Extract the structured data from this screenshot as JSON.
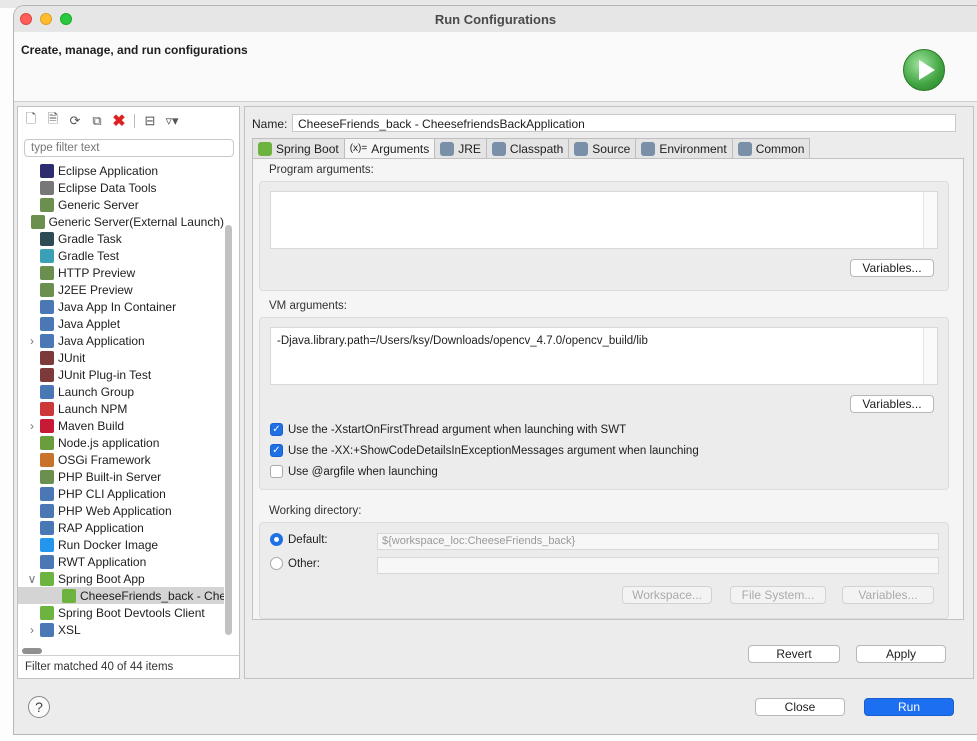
{
  "dialog": {
    "title": "Run Configurations",
    "header_text": "Create, manage, and run configurations",
    "header_icon": "run-icon"
  },
  "left_panel": {
    "filter_placeholder": "type filter text",
    "status": "Filter matched 40 of 44 items",
    "toolbar_icons": [
      "new-configuration-icon",
      "new-prototype-icon",
      "export-icon",
      "duplicate-icon",
      "delete-icon",
      "collapse-all-icon",
      "filter-icon"
    ],
    "tree": [
      {
        "label": "Eclipse Application",
        "icon": "eclipse-icon",
        "color": "#2c2c6e",
        "expandable": false
      },
      {
        "label": "Eclipse Data Tools",
        "icon": "database-icon",
        "color": "#777777",
        "expandable": false
      },
      {
        "label": "Generic Server",
        "icon": "server-icon",
        "color": "#6a8f4e",
        "expandable": false
      },
      {
        "label": "Generic Server(External Launch)",
        "icon": "server-icon",
        "color": "#6a8f4e",
        "expandable": false
      },
      {
        "label": "Gradle Task",
        "icon": "gradle-icon",
        "color": "#2d4b54",
        "expandable": false
      },
      {
        "label": "Gradle Test",
        "icon": "gradle-icon",
        "color": "#3aa0b5",
        "expandable": false
      },
      {
        "label": "HTTP Preview",
        "icon": "document-icon",
        "color": "#6a8f4e",
        "expandable": false
      },
      {
        "label": "J2EE Preview",
        "icon": "document-icon",
        "color": "#6a8f4e",
        "expandable": false
      },
      {
        "label": "Java App In Container",
        "icon": "container-icon",
        "color": "#4a78b5",
        "expandable": false
      },
      {
        "label": "Java Applet",
        "icon": "applet-icon",
        "color": "#4a78b5",
        "expandable": false
      },
      {
        "label": "Java Application",
        "icon": "java-icon",
        "color": "#4a78b5",
        "expandable": true,
        "expanded": false
      },
      {
        "label": "JUnit",
        "icon": "junit-icon",
        "color": "#7d3a3a",
        "expandable": false
      },
      {
        "label": "JUnit Plug-in Test",
        "icon": "junit-icon",
        "color": "#7d3a3a",
        "expandable": false
      },
      {
        "label": "Launch Group",
        "icon": "launch-group-icon",
        "color": "#4a78b5",
        "expandable": false
      },
      {
        "label": "Launch NPM",
        "icon": "npm-icon",
        "color": "#cb3837",
        "expandable": false
      },
      {
        "label": "Maven Build",
        "icon": "maven-icon",
        "color": "#c71a36",
        "expandable": true,
        "expanded": false
      },
      {
        "label": "Node.js application",
        "icon": "nodejs-icon",
        "color": "#6a9e3c",
        "expandable": false
      },
      {
        "label": "OSGi Framework",
        "icon": "osgi-icon",
        "color": "#c9722c",
        "expandable": false
      },
      {
        "label": "PHP Built-in Server",
        "icon": "php-icon",
        "color": "#6a8f4e",
        "expandable": false
      },
      {
        "label": "PHP CLI Application",
        "icon": "php-icon",
        "color": "#4a78b5",
        "expandable": false
      },
      {
        "label": "PHP Web Application",
        "icon": "php-icon",
        "color": "#4a78b5",
        "expandable": false
      },
      {
        "label": "RAP Application",
        "icon": "rap-icon",
        "color": "#4a78b5",
        "expandable": false
      },
      {
        "label": "Run Docker Image",
        "icon": "docker-icon",
        "color": "#2496ed",
        "expandable": false
      },
      {
        "label": "RWT Application",
        "icon": "rwt-icon",
        "color": "#4a78b5",
        "expandable": false
      },
      {
        "label": "Spring Boot App",
        "icon": "spring-boot-icon",
        "color": "#6db33f",
        "expandable": true,
        "expanded": true
      },
      {
        "label": "CheeseFriends_back - CheesefriendsBackApplication",
        "icon": "spring-boot-icon",
        "color": "#6db33f",
        "expandable": false,
        "child": true,
        "selected": true
      },
      {
        "label": "Spring Boot Devtools Client",
        "icon": "spring-devtools-icon",
        "color": "#6db33f",
        "expandable": false
      },
      {
        "label": "XSL",
        "icon": "xsl-icon",
        "color": "#4a78b5",
        "expandable": true,
        "expanded": false
      }
    ]
  },
  "right_panel": {
    "name_label": "Name:",
    "name_value": "CheeseFriends_back - CheesefriendsBackApplication",
    "tabs": [
      {
        "label": "Spring Boot",
        "icon": "spring-boot-icon",
        "active": false
      },
      {
        "label": "Arguments",
        "icon": "arguments-icon",
        "glyph": "(x)=",
        "active": true
      },
      {
        "label": "JRE",
        "icon": "jre-icon",
        "active": false
      },
      {
        "label": "Classpath",
        "icon": "classpath-icon",
        "active": false
      },
      {
        "label": "Source",
        "icon": "source-icon",
        "active": false
      },
      {
        "label": "Environment",
        "icon": "environment-icon",
        "active": false
      },
      {
        "label": "Common",
        "icon": "common-icon",
        "active": false
      }
    ],
    "program_arguments": {
      "label": "Program arguments:",
      "value": "",
      "variables_button": "Variables..."
    },
    "vm_arguments": {
      "label": "VM arguments:",
      "value": "-Djava.library.path=/Users/ksy/Downloads/opencv_4.7.0/opencv_build/lib",
      "variables_button": "Variables..."
    },
    "checkboxes": [
      {
        "label": "Use the -XstartOnFirstThread argument when launching with SWT",
        "checked": true
      },
      {
        "label": "Use the -XX:+ShowCodeDetailsInExceptionMessages argument when launching",
        "checked": true
      },
      {
        "label": "Use @argfile when launching",
        "checked": false
      }
    ],
    "working_directory": {
      "label": "Working directory:",
      "default_label": "Default:",
      "default_value": "${workspace_loc:CheeseFriends_back}",
      "other_label": "Other:",
      "other_value": "",
      "selected": "default",
      "buttons": [
        "Workspace...",
        "File System...",
        "Variables..."
      ]
    },
    "revert_button": "Revert",
    "apply_button": "Apply"
  },
  "footer": {
    "help_glyph": "?",
    "close_button": "Close",
    "run_button": "Run"
  },
  "colors": {
    "accent": "#1c6ff0",
    "spring_green": "#6db33f"
  }
}
